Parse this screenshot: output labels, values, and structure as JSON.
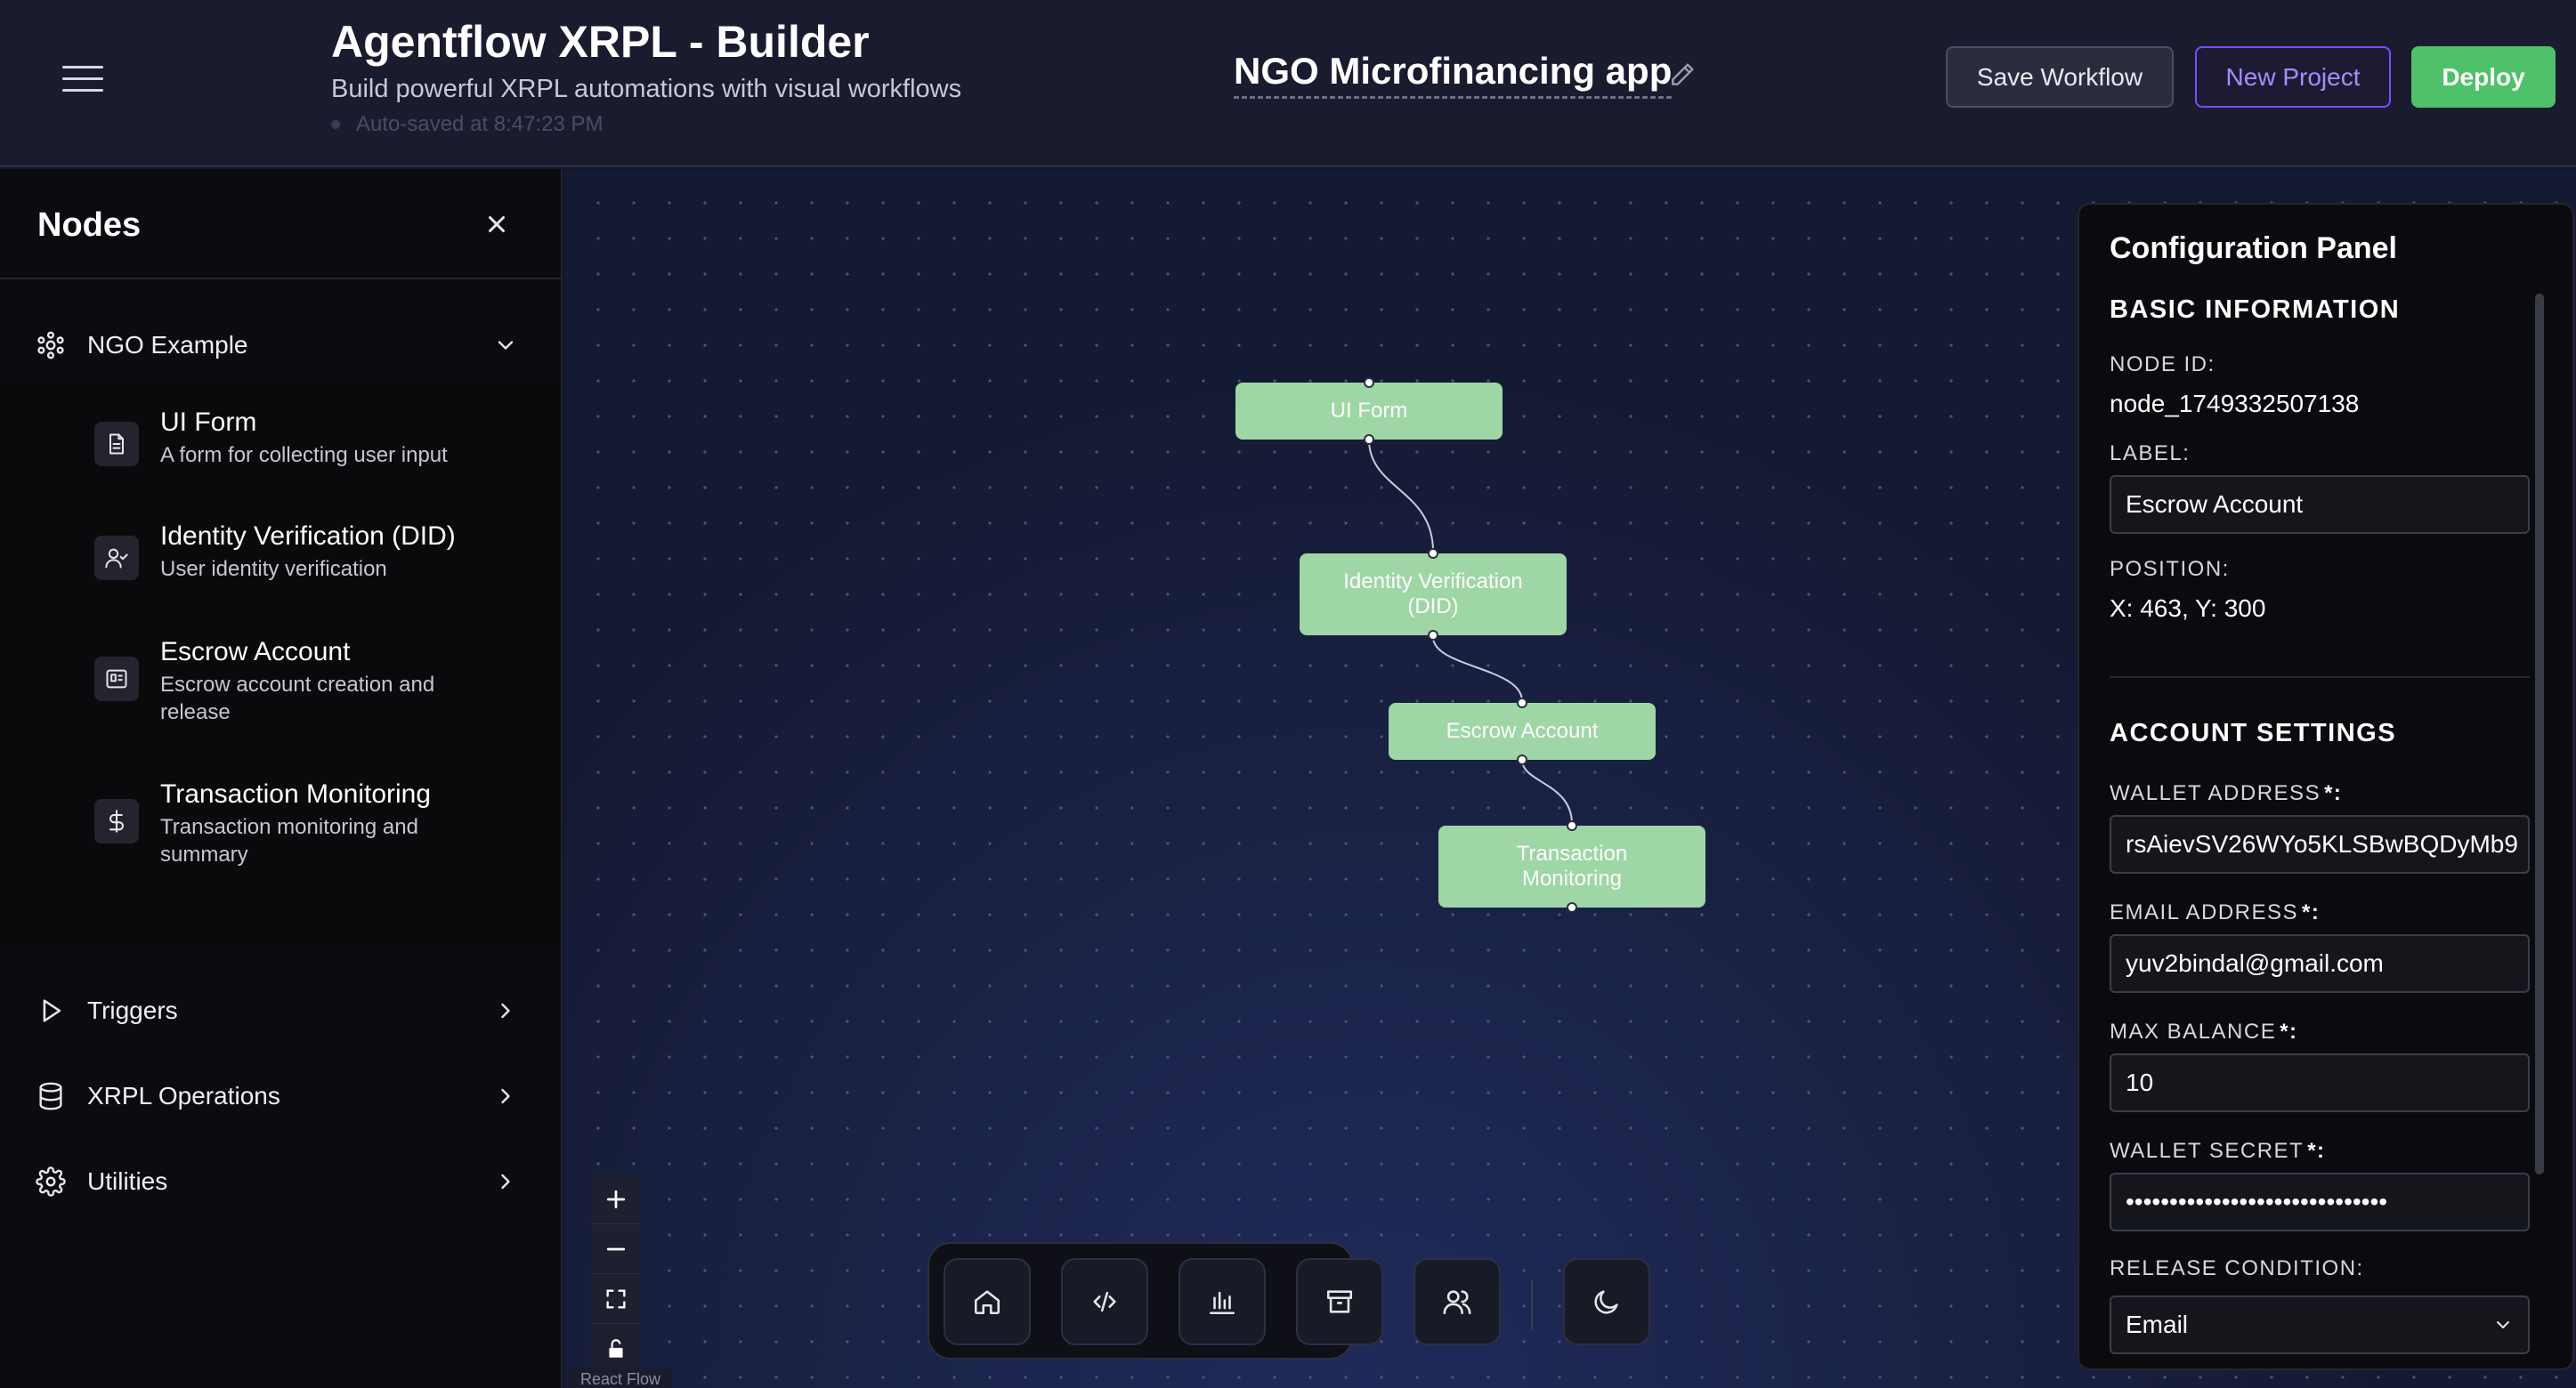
{
  "header": {
    "title": "Agentflow XRPL - Builder",
    "subtitle": "Build powerful XRPL automations with visual workflows",
    "autosave": "Auto-saved at 8:47:23 PM",
    "project_name": "NGO Microfinancing app",
    "buttons": {
      "save": "Save Workflow",
      "new_project": "New Project",
      "deploy": "Deploy"
    }
  },
  "sidebar": {
    "title": "Nodes",
    "categories": [
      {
        "label": "NGO Example",
        "icon": "ngo-icon",
        "expanded": true
      },
      {
        "label": "Triggers",
        "icon": "play-icon",
        "expanded": false
      },
      {
        "label": "XRPL Operations",
        "icon": "database-icon",
        "expanded": false
      },
      {
        "label": "Utilities",
        "icon": "gear-icon",
        "expanded": false
      }
    ],
    "ngo_nodes": [
      {
        "title": "UI Form",
        "description": "A form for collecting user input",
        "icon": "form-icon"
      },
      {
        "title": "Identity Verification (DID)",
        "description": "User identity verification",
        "icon": "user-check-icon"
      },
      {
        "title": "Escrow Account",
        "description": "Escrow account creation and release",
        "icon": "escrow-icon"
      },
      {
        "title": "Transaction Monitoring",
        "description": "Transaction monitoring and summary",
        "icon": "dollar-icon"
      }
    ]
  },
  "canvas": {
    "nodes": [
      {
        "id": "ui-form",
        "label": "UI Form"
      },
      {
        "id": "did",
        "label": "Identity Verification (DID)"
      },
      {
        "id": "escrow",
        "label": "Escrow Account"
      },
      {
        "id": "monitoring",
        "label": "Transaction Monitoring"
      }
    ],
    "attribution": "React Flow",
    "controls": [
      "zoom-in",
      "zoom-out",
      "fit-view",
      "lock"
    ],
    "dock": [
      "home-icon",
      "code-icon",
      "chart-icon",
      "archive-icon",
      "users-icon",
      "moon-icon"
    ]
  },
  "config_panel": {
    "title": "Configuration Panel",
    "basic_section": "BASIC INFORMATION",
    "node_id_label": "NODE ID:",
    "node_id": "node_1749332507138",
    "label_label": "LABEL:",
    "label_value": "Escrow Account",
    "position_label": "POSITION:",
    "position_value": "X: 463, Y: 300",
    "account_section": "ACCOUNT SETTINGS",
    "wallet_address_label": "WALLET ADDRESS",
    "wallet_address": "rsAievSV26WYo5KLSBwBQDyMb9",
    "email_label": "EMAIL ADDRESS",
    "email": "yuv2bindal@gmail.com",
    "max_balance_label": "MAX BALANCE",
    "max_balance": "10",
    "wallet_secret_label": "WALLET SECRET",
    "wallet_secret": "••••••••••••••••••••••••••••••",
    "release_condition_label": "RELEASE CONDITION:",
    "release_condition": "Email",
    "required_mark": "*:"
  },
  "colors": {
    "node_fill": "#9fd6a6",
    "deploy": "#4ec16a",
    "new_project_accent": "#7c4dff",
    "canvas_bg": "#151a33"
  }
}
